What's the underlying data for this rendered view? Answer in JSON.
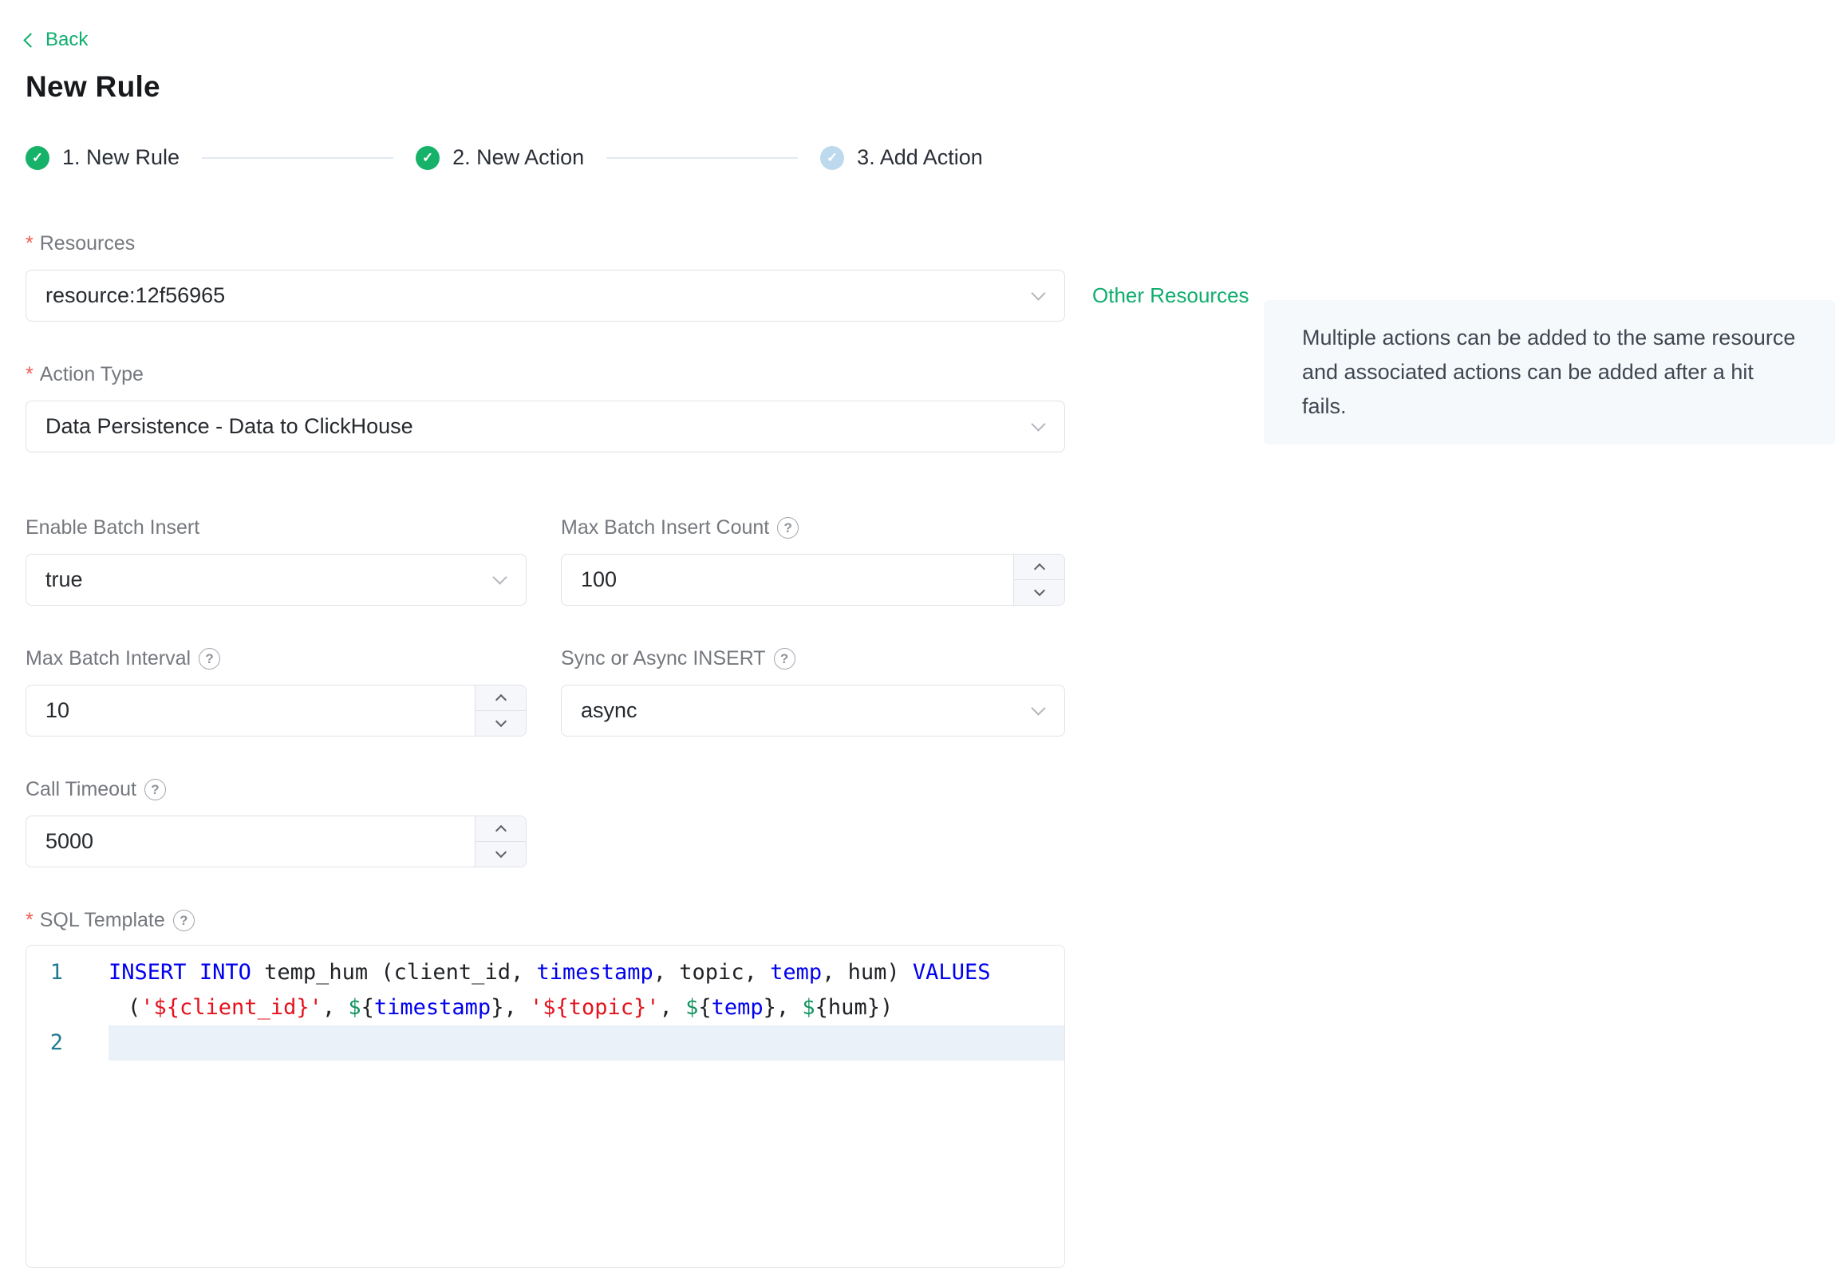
{
  "colors": {
    "green": "#0fae6e",
    "step_done": "#17b26a",
    "step_pending": "#bdd9ee",
    "required_asterisk": "#f25a50",
    "code_keyword": "#0000ee",
    "code_string": "#e4131d",
    "code_variable": "#12945f",
    "code_line_number": "#237893",
    "active_line_bg": "#eaf1f8",
    "info_box_bg": "#f5f9fc"
  },
  "icons": {
    "check": "✓",
    "help": "?",
    "required": "*"
  },
  "back": {
    "label": "Back"
  },
  "page_title": "New Rule",
  "steps": [
    {
      "label": "1. New Rule",
      "state": "done"
    },
    {
      "label": "2. New Action",
      "state": "done"
    },
    {
      "label": "3. Add Action",
      "state": "pending"
    }
  ],
  "resources": {
    "label": "Resources",
    "required": true,
    "value": "resource:12f56965",
    "other_link": "Other Resources"
  },
  "info_box": {
    "text": "Multiple actions can be added to the same resource and associated actions can be added after a hit fails."
  },
  "action_type": {
    "label": "Action Type",
    "required": true,
    "value": "Data Persistence - Data to ClickHouse"
  },
  "fields": {
    "enable_batch": {
      "label": "Enable Batch Insert",
      "value": "true"
    },
    "max_batch_count": {
      "label": "Max Batch Insert Count",
      "value": "100"
    },
    "max_batch_interval": {
      "label": "Max Batch Interval",
      "value": "10"
    },
    "sync_async": {
      "label": "Sync or Async INSERT",
      "value": "async"
    },
    "call_timeout": {
      "label": "Call Timeout",
      "value": "5000"
    }
  },
  "sql_template": {
    "label": "SQL Template",
    "required": true,
    "text": "INSERT INTO temp_hum (client_id, timestamp, topic, temp, hum) VALUES ('${client_id}', ${timestamp}, '${topic}', ${temp}, ${hum})",
    "lines": [
      {
        "num": "1",
        "active": false,
        "segments": [
          [
            {
              "t": "INSERT",
              "c": "kw"
            },
            {
              "t": " ",
              "c": "pl"
            },
            {
              "t": "INTO",
              "c": "kw"
            },
            {
              "t": " temp_hum (client_id, ",
              "c": "pl"
            },
            {
              "t": "timestamp",
              "c": "kw"
            },
            {
              "t": ", topic, ",
              "c": "pl"
            },
            {
              "t": "temp",
              "c": "kw"
            },
            {
              "t": ", hum) ",
              "c": "pl"
            },
            {
              "t": "VALUES",
              "c": "kw"
            }
          ],
          [
            {
              "t": "(",
              "c": "pl"
            },
            {
              "t": "'${client_id}'",
              "c": "str"
            },
            {
              "t": ", ",
              "c": "pl"
            },
            {
              "t": "$",
              "c": "var"
            },
            {
              "t": "{",
              "c": "pl"
            },
            {
              "t": "timestamp",
              "c": "kw"
            },
            {
              "t": "}",
              "c": "pl"
            },
            {
              "t": ", ",
              "c": "pl"
            },
            {
              "t": "'${topic}'",
              "c": "str"
            },
            {
              "t": ", ",
              "c": "pl"
            },
            {
              "t": "$",
              "c": "var"
            },
            {
              "t": "{",
              "c": "pl"
            },
            {
              "t": "temp",
              "c": "kw"
            },
            {
              "t": "}",
              "c": "pl"
            },
            {
              "t": ", ",
              "c": "pl"
            },
            {
              "t": "$",
              "c": "var"
            },
            {
              "t": "{hum})",
              "c": "pl"
            }
          ]
        ]
      },
      {
        "num": "2",
        "active": true,
        "segments": [
          []
        ]
      }
    ]
  }
}
